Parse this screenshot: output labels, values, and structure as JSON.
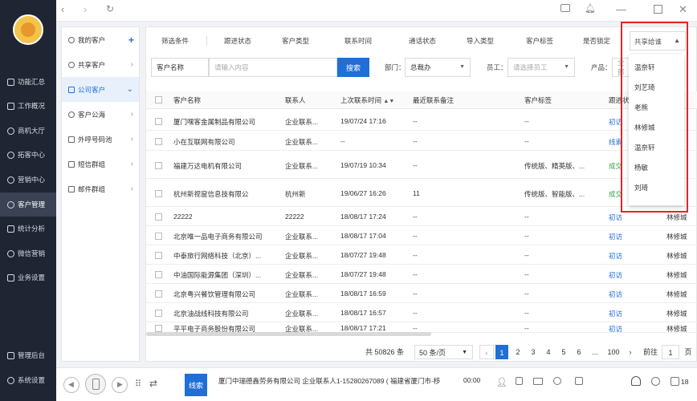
{
  "nav": {
    "items": [
      "功能汇总",
      "工作概况",
      "商机大厅",
      "拓客中心",
      "营销中心",
      "客户管理",
      "统计分析",
      "微信营销",
      "业务设置"
    ],
    "bottom_items": [
      "管理后台",
      "系统设置"
    ],
    "active": "客户管理"
  },
  "sub_nav": {
    "items": [
      "我的客户",
      "共享客户",
      "公司客户",
      "客户公海",
      "外呼号码池",
      "短信群组",
      "邮件群组"
    ],
    "active": "公司客户"
  },
  "filters": [
    "筛选条件",
    "跟进状态",
    "客户类型",
    "联系时间",
    "通话状态",
    "导入类型",
    "客户标签",
    "是否锁定"
  ],
  "dropdown": {
    "selected": "共享给谁",
    "options": [
      "温奈轩",
      "刘艺琦",
      "老熊",
      "林修城",
      "温奈轩",
      "杨敏",
      "刘琦"
    ]
  },
  "search": {
    "field": "客户名称",
    "placeholder": "请输入内容",
    "button": "搜索",
    "dept_label": "部门：",
    "dept_value": "总裁办",
    "staff_label": "员工：",
    "staff_placeholder": "请选择员工",
    "product_label": "产品：",
    "product_value": "全部"
  },
  "table": {
    "headers": [
      "客户名称",
      "联系人",
      "上次联系时间",
      "最近联系备注",
      "客户标签",
      "跟进状"
    ],
    "rows": [
      {
        "name": "厦门嘿客金属制品有限公司",
        "contact": "企业联系...",
        "time": "19/07/24 17:16",
        "note": "--",
        "tag": "--",
        "status": "初访",
        "owner": ""
      },
      {
        "name": "小在互联网有限公司",
        "contact": "企业联系...",
        "time": "--",
        "note": "--",
        "tag": "--",
        "status": "线索",
        "owner": ""
      },
      {
        "name": "福建万达电机有限公司",
        "contact": "企业联系...",
        "time": "19/07/19 10:34",
        "note": "--",
        "tag": "传统版、精英版、...",
        "status": "成交",
        "owner": ""
      },
      {
        "name": "杭州新视窗信息技有限公",
        "contact": "杭州新",
        "time": "19/06/27 16:26",
        "note": "11",
        "tag": "传统版、智能版、...",
        "status": "成交",
        "owner": ""
      },
      {
        "name": "22222",
        "contact": "22222",
        "time": "18/08/17 17:24",
        "note": "--",
        "tag": "--",
        "status": "初访",
        "owner": "林修城"
      },
      {
        "name": "北京唯一品电子商务有限公司",
        "contact": "企业联系...",
        "time": "18/08/17 17:04",
        "note": "--",
        "tag": "--",
        "status": "初访",
        "owner": "林修城"
      },
      {
        "name": "中泰旅行网络科技（北京）...",
        "contact": "企业联系...",
        "time": "18/07/27 19:48",
        "note": "--",
        "tag": "--",
        "status": "初访",
        "owner": "林修城"
      },
      {
        "name": "中油国际能源集团（深圳）...",
        "contact": "企业联系...",
        "time": "18/07/27 19:48",
        "note": "--",
        "tag": "--",
        "status": "初访",
        "owner": "林修城"
      },
      {
        "name": "北京粤兴餐饮管理有限公司",
        "contact": "企业联系...",
        "time": "18/08/17 16:59",
        "note": "--",
        "tag": "--",
        "status": "初访",
        "owner": "林修城"
      },
      {
        "name": "北京油战线科技有限公司",
        "contact": "企业联系...",
        "time": "18/08/17 16:57",
        "note": "--",
        "tag": "--",
        "status": "初访",
        "owner": "林修城"
      },
      {
        "name": "平平电子商务股份有限公司",
        "contact": "企业联系...",
        "time": "18/08/17 17:21",
        "note": "--",
        "tag": "--",
        "status": "初访",
        "owner": "林修城"
      }
    ]
  },
  "pagination": {
    "total": "共 50826 条",
    "page_size": "50 条/页",
    "pages": [
      "1",
      "2",
      "3",
      "4",
      "5",
      "6",
      "...",
      "100"
    ],
    "goto_label": "前往",
    "goto_value": "1",
    "page_unit": "页"
  },
  "call_bar": {
    "button": "线索",
    "info": "厦门中瑞德鑫劳务有限公司   企业联系人1-15280267089 ( 福建省厦门市-移",
    "timer": "00:00",
    "badge": "18"
  },
  "colors": {
    "accent": "#1f6fd6",
    "nav_bg": "#1f2532",
    "highlight_border": "#e0262b",
    "success": "#3aa34a"
  }
}
